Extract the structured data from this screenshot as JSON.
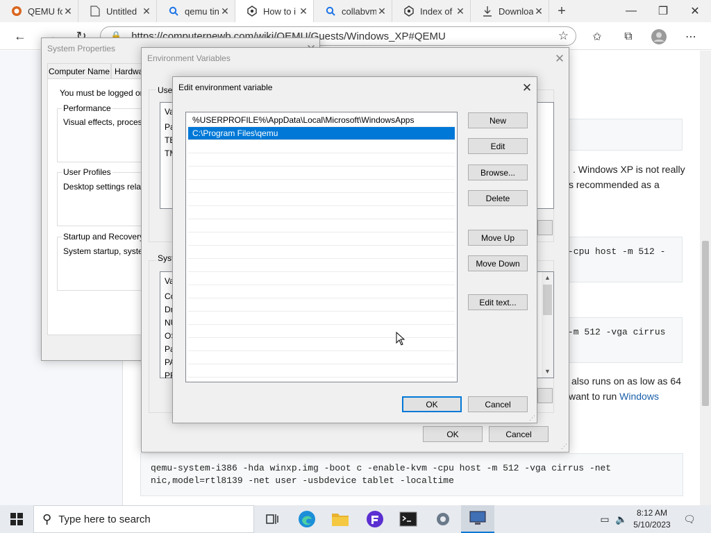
{
  "browser": {
    "tabs": [
      {
        "title": "QEMU fo",
        "icon": "qemu-icon"
      },
      {
        "title": "Untitled",
        "icon": "page-icon"
      },
      {
        "title": "qemu tin",
        "icon": "search-icon"
      },
      {
        "title": "How to i",
        "icon": "wiki-icon"
      },
      {
        "title": "collabvm",
        "icon": "search-icon"
      },
      {
        "title": "Index of",
        "icon": "wiki-icon"
      },
      {
        "title": "Downloa",
        "icon": "download-icon"
      }
    ],
    "new_tab": "+",
    "url": "https://computernewb.com/wiki/QEMU/Guests/Windows_XP#QEMU"
  },
  "page": {
    "text1a": ". Windows XP is not really",
    "text1b": "s recommended as a",
    "code1": "-cpu host -m 512 -",
    "code2": "-m 512 -vga cirrus",
    "text2a": "also runs on as low as 64",
    "text2b_prefix": "want to run ",
    "text2b_link": "Windows",
    "code3_line1": "qemu-system-i386 -hda winxp.img -boot c -enable-kvm -cpu host -m 512 -vga cirrus -net",
    "code3_line2": "nic,model=rtl8139 -net user -usbdevice tablet -localtime"
  },
  "system_properties": {
    "title": "System Properties",
    "tabs": [
      "Computer Name",
      "Hardwa"
    ],
    "logged_on": "You must be logged on a",
    "performance_label": "Performance",
    "performance_text": "Visual effects, processo",
    "user_profiles_label": "User Profiles",
    "user_profiles_text": "Desktop settings related",
    "startup_label": "Startup and Recovery",
    "startup_text": "System startup, system f"
  },
  "environment_variables": {
    "title": "Environment Variables",
    "user_label": "User",
    "user_col": "Va",
    "user_rows": [
      "Pa",
      "TE",
      "TM"
    ],
    "system_label": "Syste",
    "system_col": "Va",
    "system_rows": [
      "Co",
      "Dr",
      "NU",
      "OS",
      "Pa",
      "PA",
      "PR"
    ],
    "ok": "OK",
    "cancel": "Cancel"
  },
  "edit_dialog": {
    "title": "Edit environment variable",
    "entries": [
      "%USERPROFILE%\\AppData\\Local\\Microsoft\\WindowsApps",
      "C:\\Program Files\\qemu"
    ],
    "selected_index": 1,
    "buttons": {
      "new": "New",
      "edit": "Edit",
      "browse": "Browse...",
      "delete": "Delete",
      "move_up": "Move Up",
      "move_down": "Move Down",
      "edit_text": "Edit text..."
    },
    "ok": "OK",
    "cancel": "Cancel"
  },
  "taskbar": {
    "search_placeholder": "Type here to search",
    "time": "8:12 AM",
    "date": "5/10/2023"
  },
  "colors": {
    "accent": "#0078d7",
    "link": "#1a5faa"
  }
}
